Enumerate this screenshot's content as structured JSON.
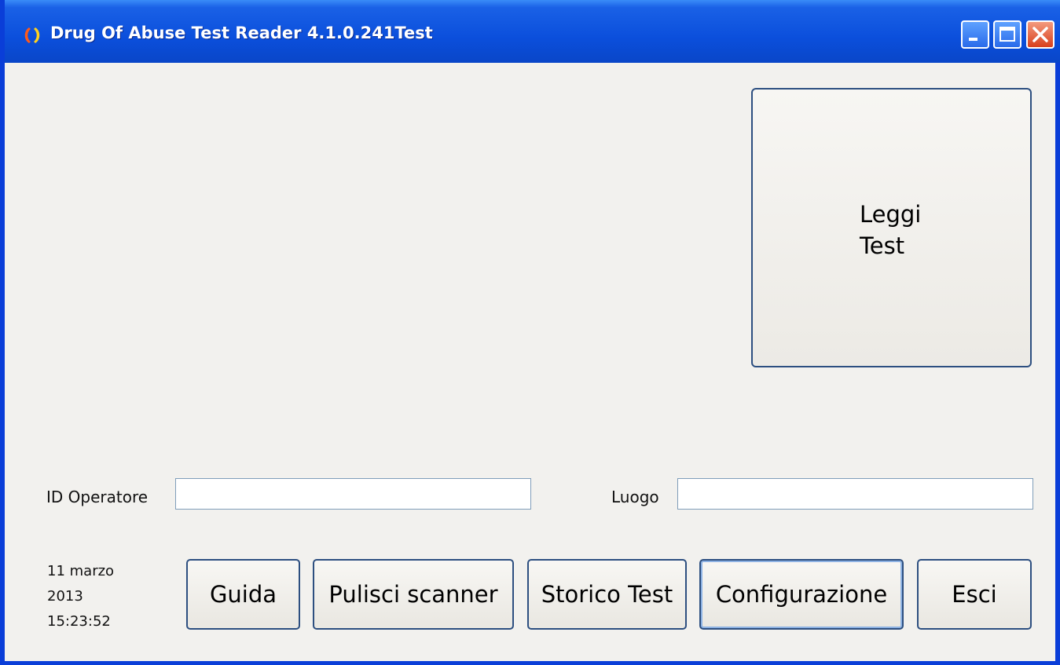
{
  "window": {
    "title": "Drug Of Abuse Test Reader 4.1.0.241Test",
    "buttons": [
      "minimize",
      "maximize",
      "close"
    ]
  },
  "main": {
    "read_button_line1": "Leggi",
    "read_button_line2": "Test"
  },
  "form": {
    "operator_label": "ID Operatore",
    "operator_value": "",
    "location_label": "Luogo",
    "location_value": ""
  },
  "status": {
    "date_line1": "11 marzo",
    "date_line2": "2013",
    "time": "15:23:52"
  },
  "toolbar": {
    "help_label": "Guida",
    "clean_label": "Pulisci scanner",
    "history_label": "Storico Test",
    "config_label": "Configurazione",
    "exit_label": "Esci"
  },
  "colors": {
    "titlebar": "#0b4fdc",
    "window_bg": "#f2f1ee",
    "button_border": "#2d4f80",
    "close_button": "#d8401c"
  }
}
